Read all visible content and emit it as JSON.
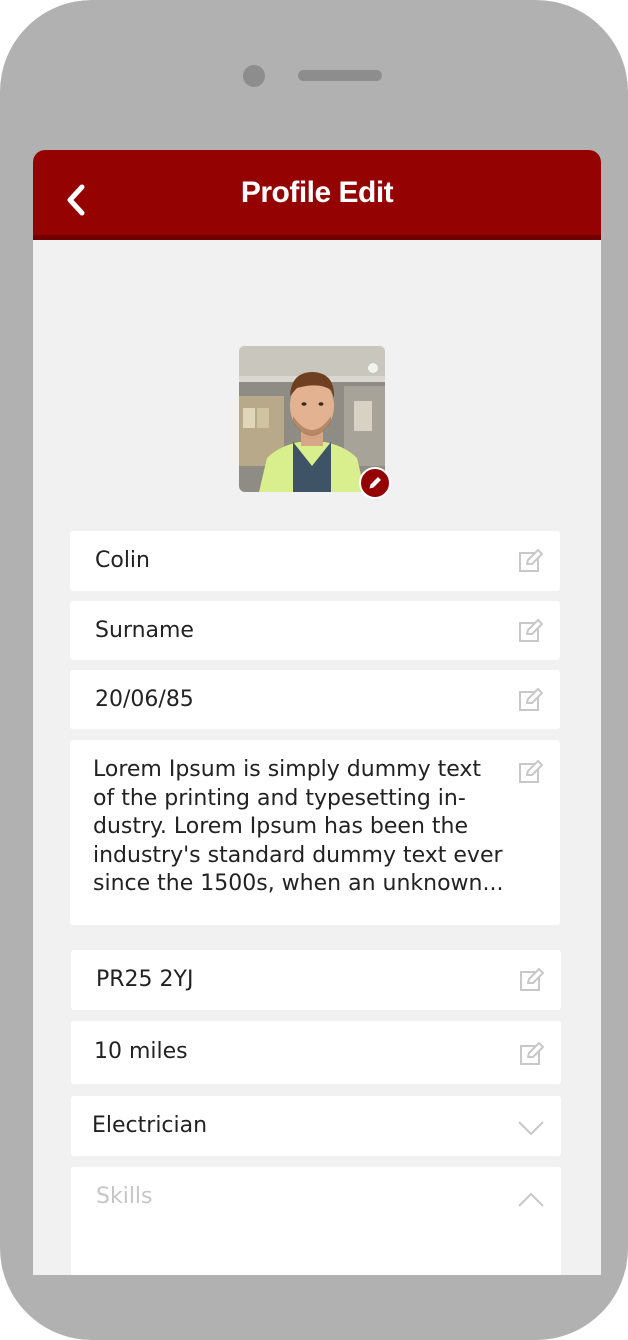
{
  "header": {
    "title": "Profile Edit"
  },
  "profile": {
    "first_name": "Colin",
    "surname_placeholder": "Surname",
    "date_of_birth": "20/06/85",
    "bio": "Lorem Ipsum is simply dummy text\nof the printing and typesetting in-\ndustry. Lorem Ipsum has been the\nindustry's standard dummy text ever\nsince the 1500s, when an unknown...",
    "postcode": "PR25 2YJ",
    "travel_distance": "10 miles",
    "trade": "Electrician",
    "skills_placeholder": "Skills"
  },
  "icons": {
    "back": "chevron-left-icon",
    "edit": "edit-icon",
    "avatar_edit": "pencil-icon",
    "dropdown_closed": "chevron-down-icon",
    "dropdown_open": "chevron-up-icon"
  },
  "colors": {
    "brand": "#950202",
    "brand_dark": "#700000",
    "background": "#f1f1f1",
    "field": "#ffffff",
    "icon_muted": "#c8c8c8",
    "device": "#b1b1b1"
  }
}
